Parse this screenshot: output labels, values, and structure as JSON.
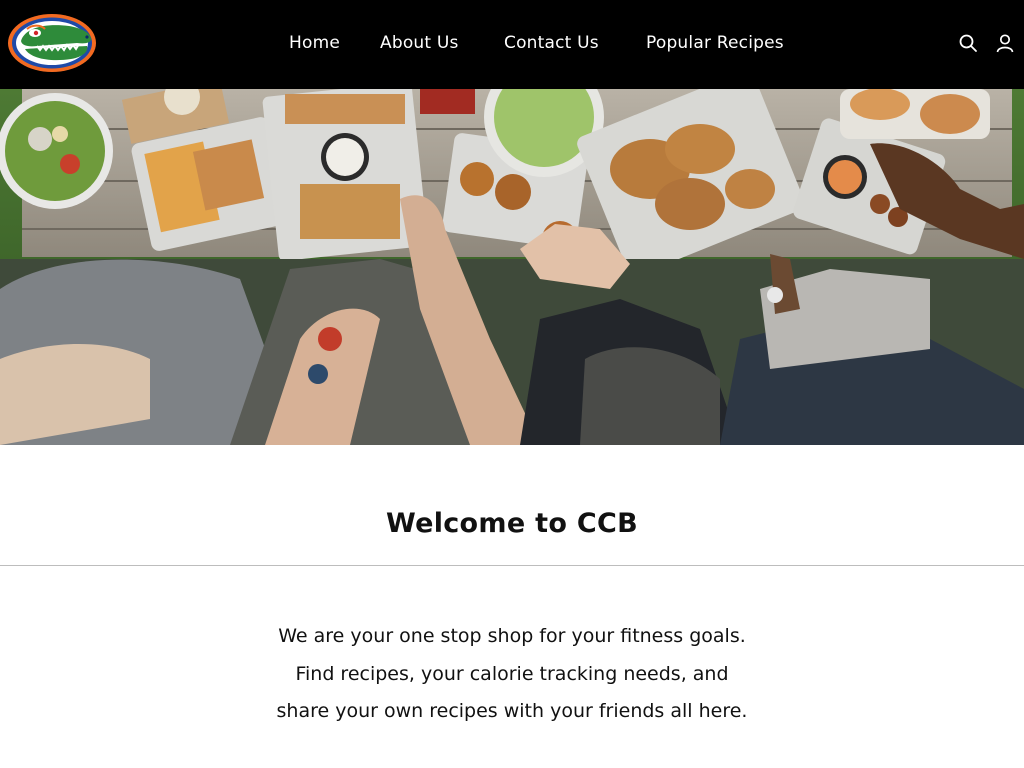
{
  "header": {
    "logo_icon": "gator-logo-icon",
    "nav": {
      "home": "Home",
      "about": "About Us",
      "contact": "Contact Us",
      "popular": "Popular Recipes"
    },
    "icons": [
      "search-icon",
      "user-icon"
    ]
  },
  "hero": {
    "image": "overhead-picnic-table-food-photo"
  },
  "main": {
    "title": "Welcome to CCB",
    "intro_lines": [
      "We are your one stop shop for your fitness goals.",
      "Find recipes, your calorie tracking needs, and",
      "share your own recipes with your friends all here."
    ]
  },
  "colors": {
    "header_bg": "#000000",
    "nav_text": "#ffffff",
    "page_bg": "#ffffff",
    "divider": "#bdbdbd",
    "logo_orange": "#f26a21",
    "logo_blue": "#1f4aa8",
    "logo_green": "#2e8b3a"
  }
}
